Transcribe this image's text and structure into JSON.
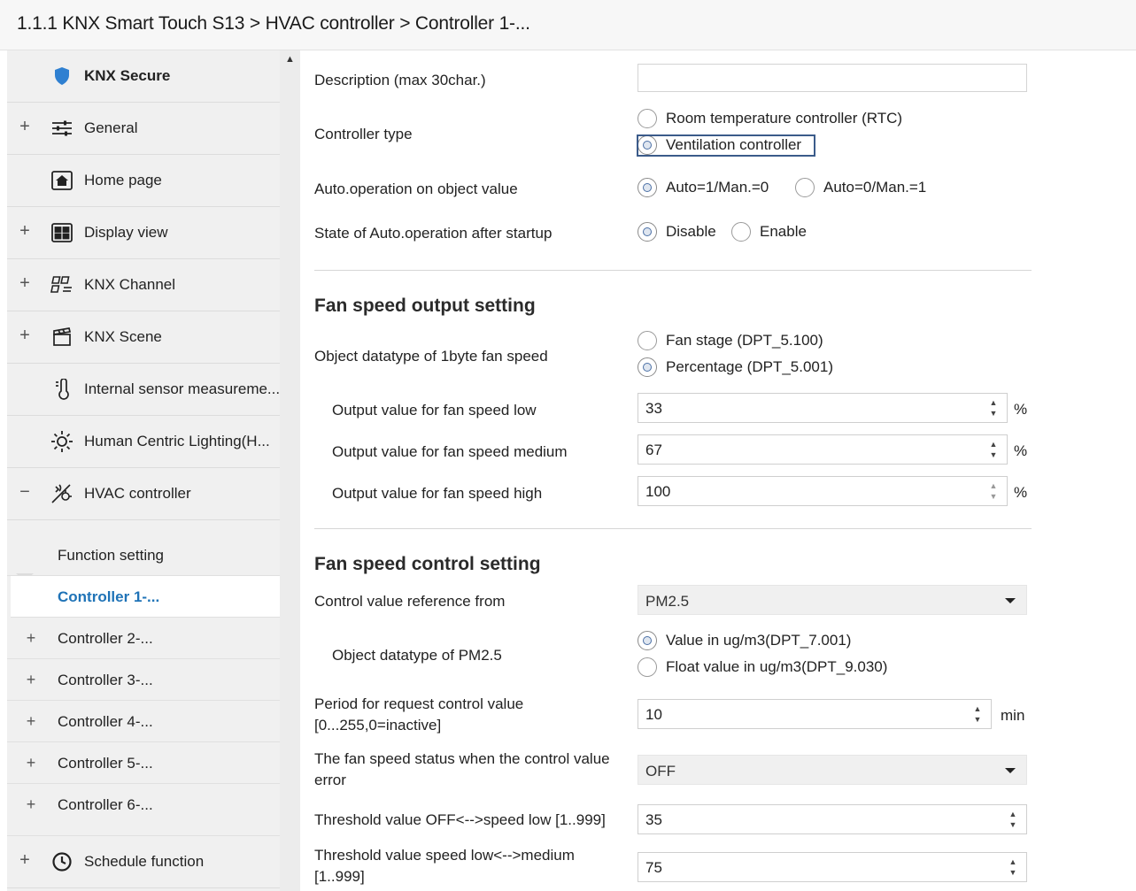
{
  "breadcrumb": "1.1.1 KNX Smart Touch S13 > HVAC controller > Controller 1-...",
  "sidebar": {
    "items": [
      {
        "label": "KNX Secure",
        "icon": "shield-icon",
        "expander": ""
      },
      {
        "label": "General",
        "icon": "sliders-icon",
        "expander": "+"
      },
      {
        "label": "Home page",
        "icon": "home-icon",
        "expander": ""
      },
      {
        "label": "Display view",
        "icon": "grid-icon",
        "expander": "+"
      },
      {
        "label": "KNX Channel",
        "icon": "channel-icon",
        "expander": "+"
      },
      {
        "label": "KNX Scene",
        "icon": "clapperboard-icon",
        "expander": "+"
      },
      {
        "label": "Internal sensor measureme...",
        "icon": "thermometer-icon",
        "expander": ""
      },
      {
        "label": "Human Centric Lighting(H...",
        "icon": "sun-icon",
        "expander": ""
      },
      {
        "label": "HVAC controller",
        "icon": "hvac-icon",
        "expander": "−"
      }
    ],
    "subitems": [
      {
        "label": "Function setting",
        "expander": ""
      },
      {
        "label": "Controller 1-...",
        "expander": ""
      },
      {
        "label": "Controller 2-...",
        "expander": "+"
      },
      {
        "label": "Controller 3-...",
        "expander": "+"
      },
      {
        "label": "Controller 4-...",
        "expander": "+"
      },
      {
        "label": "Controller 5-...",
        "expander": "+"
      },
      {
        "label": "Controller 6-...",
        "expander": "+"
      }
    ],
    "bottom_item": {
      "label": "Schedule function",
      "icon": "clock-icon",
      "expander": "+"
    }
  },
  "form": {
    "description": {
      "label": "Description (max 30char.)",
      "value": ""
    },
    "controller_type": {
      "label": "Controller type",
      "options": [
        "Room temperature controller (RTC)",
        "Ventilation controller"
      ],
      "selected": 1
    },
    "auto_operation": {
      "label": "Auto.operation on object value",
      "options": [
        "Auto=1/Man.=0",
        "Auto=0/Man.=1"
      ],
      "selected": 0
    },
    "auto_state": {
      "label": "State of Auto.operation after startup",
      "options": [
        "Disable",
        "Enable"
      ],
      "selected": 0
    },
    "section_output": "Fan speed output setting",
    "datatype_1byte": {
      "label": "Object datatype of 1byte fan speed",
      "options": [
        "Fan stage (DPT_5.100)",
        "Percentage (DPT_5.001)"
      ],
      "selected": 1
    },
    "out_low": {
      "label": "Output value for fan speed low",
      "value": "33",
      "unit": "%"
    },
    "out_medium": {
      "label": "Output value for fan speed medium",
      "value": "67",
      "unit": "%"
    },
    "out_high": {
      "label": "Output value for fan speed high",
      "value": "100",
      "unit": "%"
    },
    "section_control": "Fan speed control setting",
    "ref_from": {
      "label": "Control value reference from",
      "value": "PM2.5"
    },
    "pm_datatype": {
      "label": "Object datatype of PM2.5",
      "options": [
        "Value in ug/m3(DPT_7.001)",
        "Float value in ug/m3(DPT_9.030)"
      ],
      "selected": 0
    },
    "period": {
      "label_1": "Period for request control value",
      "label_2": "[0...255,0=inactive]",
      "value": "10",
      "unit": "min"
    },
    "error_status": {
      "label_1": "The fan speed status when the control value",
      "label_2": "error",
      "value": "OFF"
    },
    "thr_off_low": {
      "label": "Threshold value OFF<-->speed low [1..999]",
      "value": "35"
    },
    "thr_low_med": {
      "label_1": "Threshold value speed low<-->medium",
      "label_2": "[1..999]",
      "value": "75"
    }
  },
  "colors": {
    "accent": "#1f73b7",
    "shield": "#2f80d1",
    "sidebar_bg": "#f0f0f0"
  }
}
